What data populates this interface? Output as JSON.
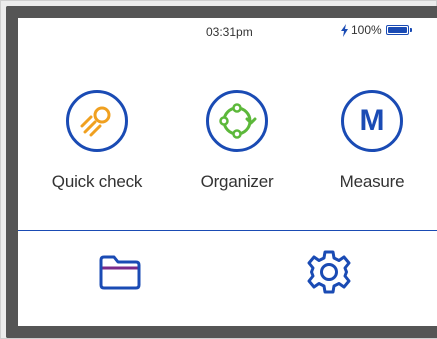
{
  "status": {
    "time": "03:31pm",
    "battery_percent": "100%",
    "battery_level": 1.0,
    "charging_icon": "lightning-bolt-icon"
  },
  "apps": [
    {
      "label": "Quick check",
      "icon": "meteor-icon"
    },
    {
      "label": "Organizer",
      "icon": "cycle-arrows-icon"
    },
    {
      "label": "Measure",
      "icon": "m-letter-icon",
      "icon_text": "M"
    }
  ],
  "bottom_icons": [
    {
      "icon": "folder-icon"
    },
    {
      "icon": "gear-icon"
    }
  ],
  "colors": {
    "accent": "#1a4bb4",
    "quick_check": "#f0a020",
    "organizer": "#5cb83a",
    "folder_stripe": "#7a2a8a",
    "bezel": "#555555"
  }
}
